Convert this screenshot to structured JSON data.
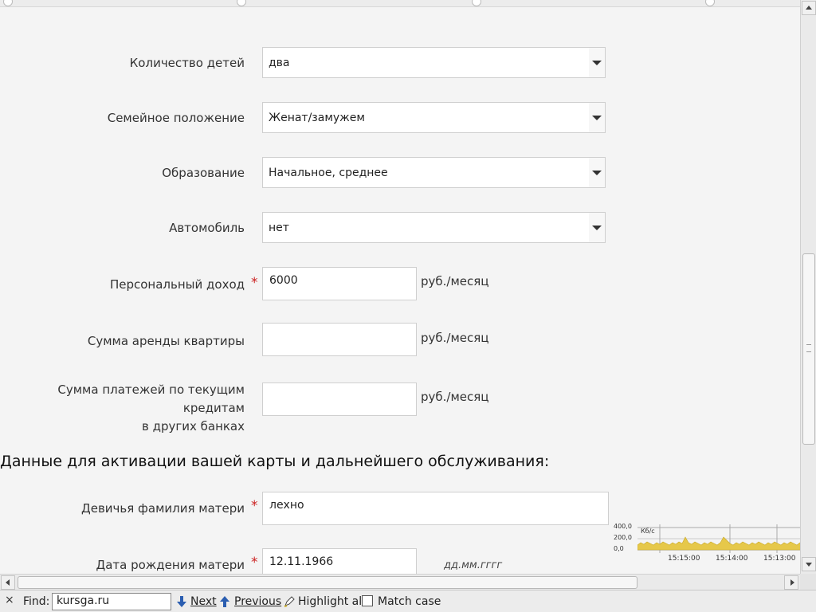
{
  "form": {
    "children_label": "Количество детей",
    "children_value": "два",
    "marital_label": "Семейное положение",
    "marital_value": "Женат/замужем",
    "education_label": "Образование",
    "education_value": "Начальное, среднее",
    "car_label": "Автомобиль",
    "car_value": "нет",
    "income_label": "Персональный доход",
    "income_value": "6000",
    "income_unit": "руб./месяц",
    "rent_label": "Сумма аренды квартиры",
    "rent_value": "",
    "rent_unit": "руб./месяц",
    "loans_label_line1": "Сумма платежей по текущим кредитам",
    "loans_label_line2": "в других банках",
    "loans_value": "",
    "loans_unit": "руб./месяц",
    "required_mark": "*"
  },
  "activation": {
    "section_title": "Данные для активации вашей карты и дальнейшего обслуживания:",
    "maiden_label": "Девичья фамилия матери",
    "maiden_value": "лехно",
    "mother_dob_label": "Дата рождения матери",
    "mother_dob_value": "12.11.1966",
    "mother_dob_hint": "дд.мм.гггг"
  },
  "traffic": {
    "y_labels": [
      "400,0",
      "200,0",
      "0,0"
    ],
    "unit": "Кб/с",
    "x_labels": [
      "15:15:00",
      "15:14:00",
      "15:13:00"
    ],
    "fill_color": "#e6c84a"
  },
  "findbar": {
    "close_glyph": "×",
    "find_label": "Find:",
    "query": "kursga.ru",
    "next_label": "Next",
    "previous_label": "Previous",
    "highlight_label": "Highlight all",
    "match_case_label": "Match case"
  }
}
